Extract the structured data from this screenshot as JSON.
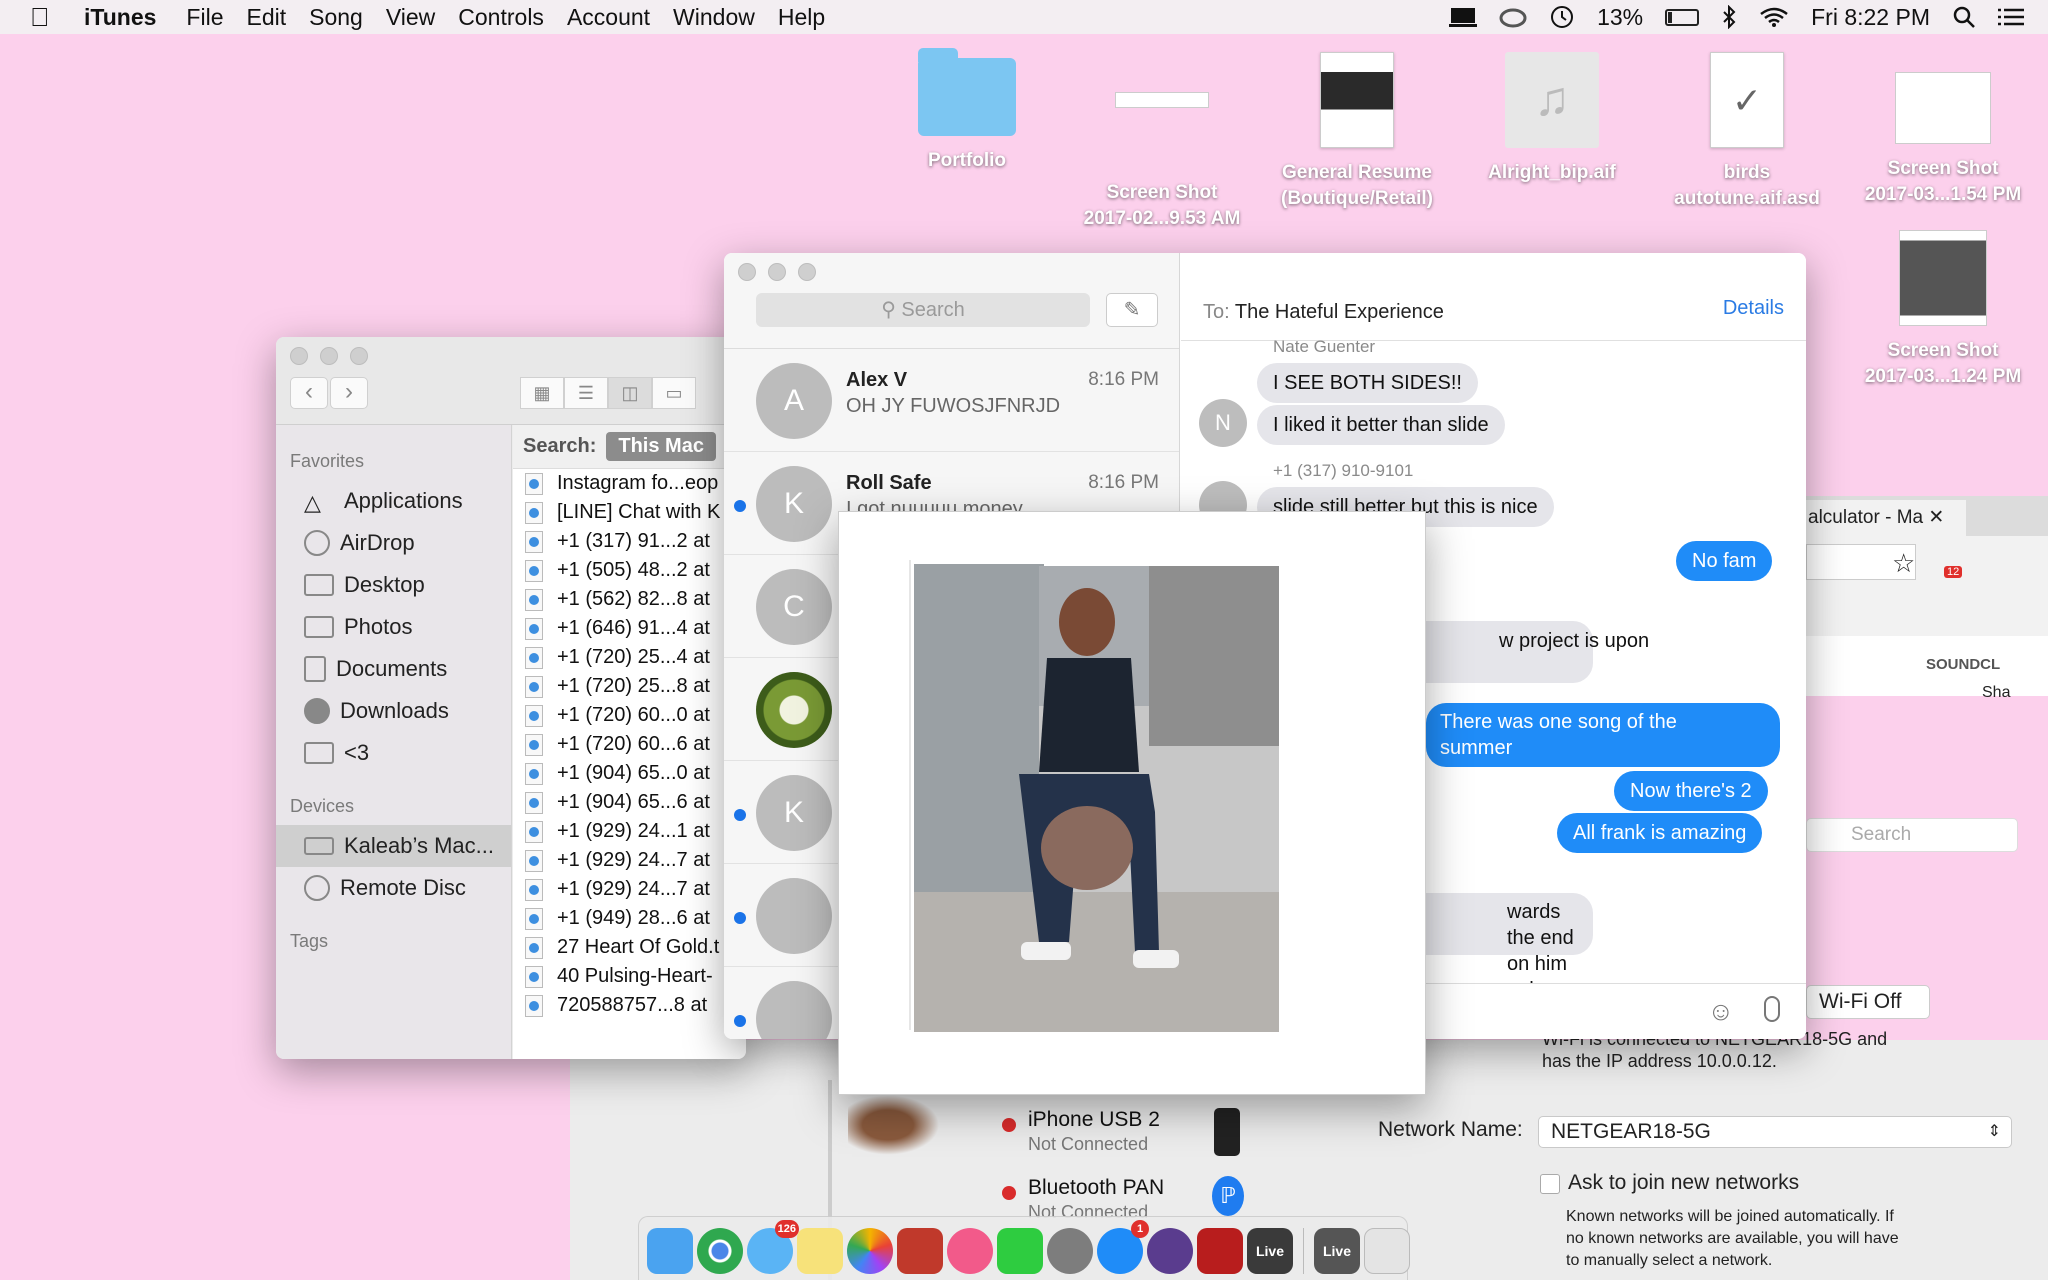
{
  "menubar": {
    "app_name": "iTunes",
    "menus": [
      "File",
      "Edit",
      "Song",
      "View",
      "Controls",
      "Account",
      "Window",
      "Help"
    ],
    "battery_percent": "13%",
    "battery_level": 0.13,
    "clock": "Fri 8:22 PM"
  },
  "desktop": {
    "icons": [
      {
        "label": "Portfolio",
        "label2": ""
      },
      {
        "label": "Screen Shot",
        "label2": "2017-02...9.53 AM"
      },
      {
        "label": "General Resume",
        "label2": "(Boutique/Retail)"
      },
      {
        "label": "Alright_bip.aif",
        "label2": ""
      },
      {
        "label": "birds",
        "label2": "autotune.aif.asd"
      },
      {
        "label": "Screen Shot",
        "label2": "2017-03...1.54 PM"
      },
      {
        "label": "Screen Shot",
        "label2": "2017-03...1.24 PM"
      }
    ],
    "partial_label": ".aif"
  },
  "finder": {
    "sidebar": {
      "favorites_header": "Favorites",
      "favorites": [
        "Applications",
        "AirDrop",
        "Desktop",
        "Photos",
        "Documents",
        "Downloads",
        "<3"
      ],
      "devices_header": "Devices",
      "devices": [
        "Kaleab’s Mac...",
        "Remote Disc"
      ],
      "tags_header": "Tags"
    },
    "search_label": "Search:",
    "scope": "This Mac",
    "results": [
      "Instagram fo...eop",
      "[LINE] Chat with K",
      "+1 (317) 91...2 at",
      "+1 (505) 48...2 at",
      "+1 (562) 82...8 at",
      "+1 (646) 91...4 at",
      "+1 (720) 25...4 at",
      "+1 (720) 25...8 at",
      "+1 (720) 60...0 at",
      "+1 (720) 60...6 at",
      "+1 (904) 65...0 at",
      "+1 (904) 65...6 at",
      "+1 (929) 24...1 at",
      "+1 (929) 24...7 at",
      "+1 (929) 24...7 at",
      "+1 (949) 28...6 at",
      "27 Heart Of Gold.t",
      "40 Pulsing-Heart-",
      "720588757...8 at"
    ]
  },
  "messages": {
    "search_placeholder": "Search",
    "conversations": [
      {
        "initial": "A",
        "name": "Alex V",
        "time": "8:16 PM",
        "preview": "OH JY FUWOSJFNRJD",
        "unread": false
      },
      {
        "initial": "K",
        "name": "Roll Safe",
        "time": "8:16 PM",
        "preview": "I got nuuuuu money",
        "unread": true
      },
      {
        "initial": "C",
        "name": "",
        "time": "",
        "preview": "",
        "unread": false
      },
      {
        "initial": "",
        "name": "",
        "time": "",
        "preview": "",
        "unread": false
      },
      {
        "initial": "K",
        "name": "",
        "time": "",
        "preview": "",
        "unread": true
      },
      {
        "initial": "",
        "name": "",
        "time": "",
        "preview": "",
        "unread": true
      },
      {
        "initial": "",
        "name": "",
        "time": "",
        "preview": "",
        "unread": true
      }
    ],
    "chat": {
      "to_label": "To:",
      "to": "The Hateful Experience",
      "details": "Details",
      "sender1": "Nate Guenter",
      "sender1_initial": "N",
      "sender2": "+1 (317) 910-9101",
      "bubbles": [
        "I SEE BOTH SIDES!!",
        "I liked it better than slide",
        "slide still better but this is nice",
        "No fam",
        "w project is upon",
        "There was one song of the",
        "summer",
        "Now there's 2",
        "All frank is amazing",
        "wards the end",
        "on him ugh"
      ]
    }
  },
  "browser": {
    "tab_title": "alculator - Ma",
    "badge": "12",
    "soundcloud": "SOUNDCL",
    "share": "Sha",
    "search_placeholder": "Search"
  },
  "network": {
    "wifi_button": "Wi-Fi Off",
    "status_line1": "Wi-Fi is connected to NETGEAR18-5G and",
    "status_line2": "has the IP address 10.0.0.12.",
    "network_name_label": "Network Name:",
    "network_name": "NETGEAR18-5G",
    "ask_join": "Ask to join new networks",
    "known_note1": "Known networks will be joined automatically. If",
    "known_note2": "no known networks are available, you will have",
    "known_note3": "to manually select a network.",
    "services": [
      {
        "name": "iPhone USB 2",
        "status": "Not Connected"
      },
      {
        "name": "Bluetooth PAN",
        "status": "Not Connected"
      }
    ]
  },
  "dock": {
    "messages_badge": "126",
    "appstore_badge": "1",
    "live_label": "Live"
  }
}
